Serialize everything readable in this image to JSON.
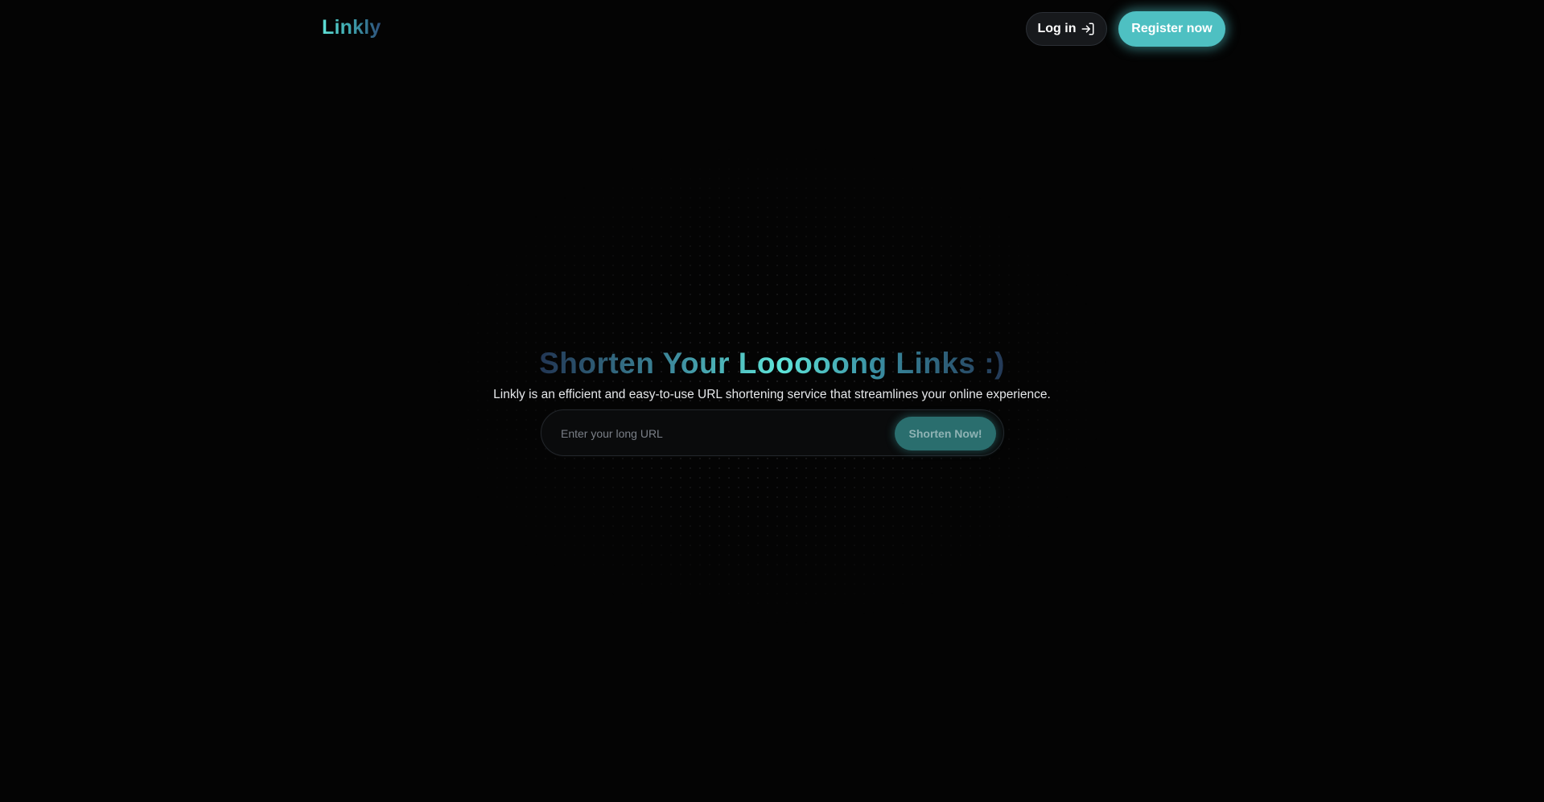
{
  "header": {
    "logo": "Linkly",
    "login_label": "Log in",
    "register_label": "Register now"
  },
  "hero": {
    "title": "Shorten Your Looooong Links :)",
    "subtitle": "Linkly is an efficient and easy-to-use URL shortening service that streamlines your online experience."
  },
  "form": {
    "url_placeholder": "Enter your long URL",
    "url_value": "",
    "submit_label": "Shorten Now!"
  },
  "icons": {
    "login": "sign-in-arrow-icon"
  },
  "colors": {
    "background": "#040404",
    "accent": "#4ec0c2",
    "accent_dark": "#2a6e6e",
    "title_gradient_mid": "#5fe6da",
    "title_gradient_edge": "#223654"
  }
}
